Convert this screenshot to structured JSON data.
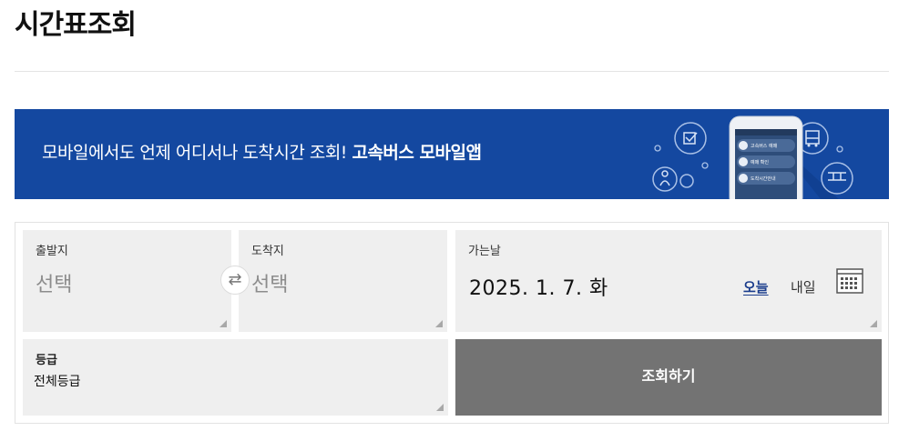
{
  "page": {
    "title": "시간표조회"
  },
  "banner": {
    "text_regular": "모바일에서도 언제 어디서나 도착시간 조회! ",
    "text_bold": "고속버스 모바일앱",
    "phone_menu": [
      "고속버스 예매",
      "예매 확인",
      "도착시간안내"
    ],
    "background_color": "#1448a0"
  },
  "form": {
    "departure": {
      "label": "출발지",
      "value": "선택"
    },
    "swap_icon": "⇄",
    "arrival": {
      "label": "도착지",
      "value": "선택"
    },
    "date": {
      "label": "가는날",
      "value": "2025. 1. 7. 화",
      "today_label": "오늘",
      "tomorrow_label": "내일"
    },
    "grade": {
      "label": "등급",
      "value": "전체등급"
    },
    "search_label": "조회하기"
  },
  "colors": {
    "accent": "#1448a0",
    "link": "#1a3c8c",
    "button": "#737373",
    "field_bg": "#efefef"
  }
}
